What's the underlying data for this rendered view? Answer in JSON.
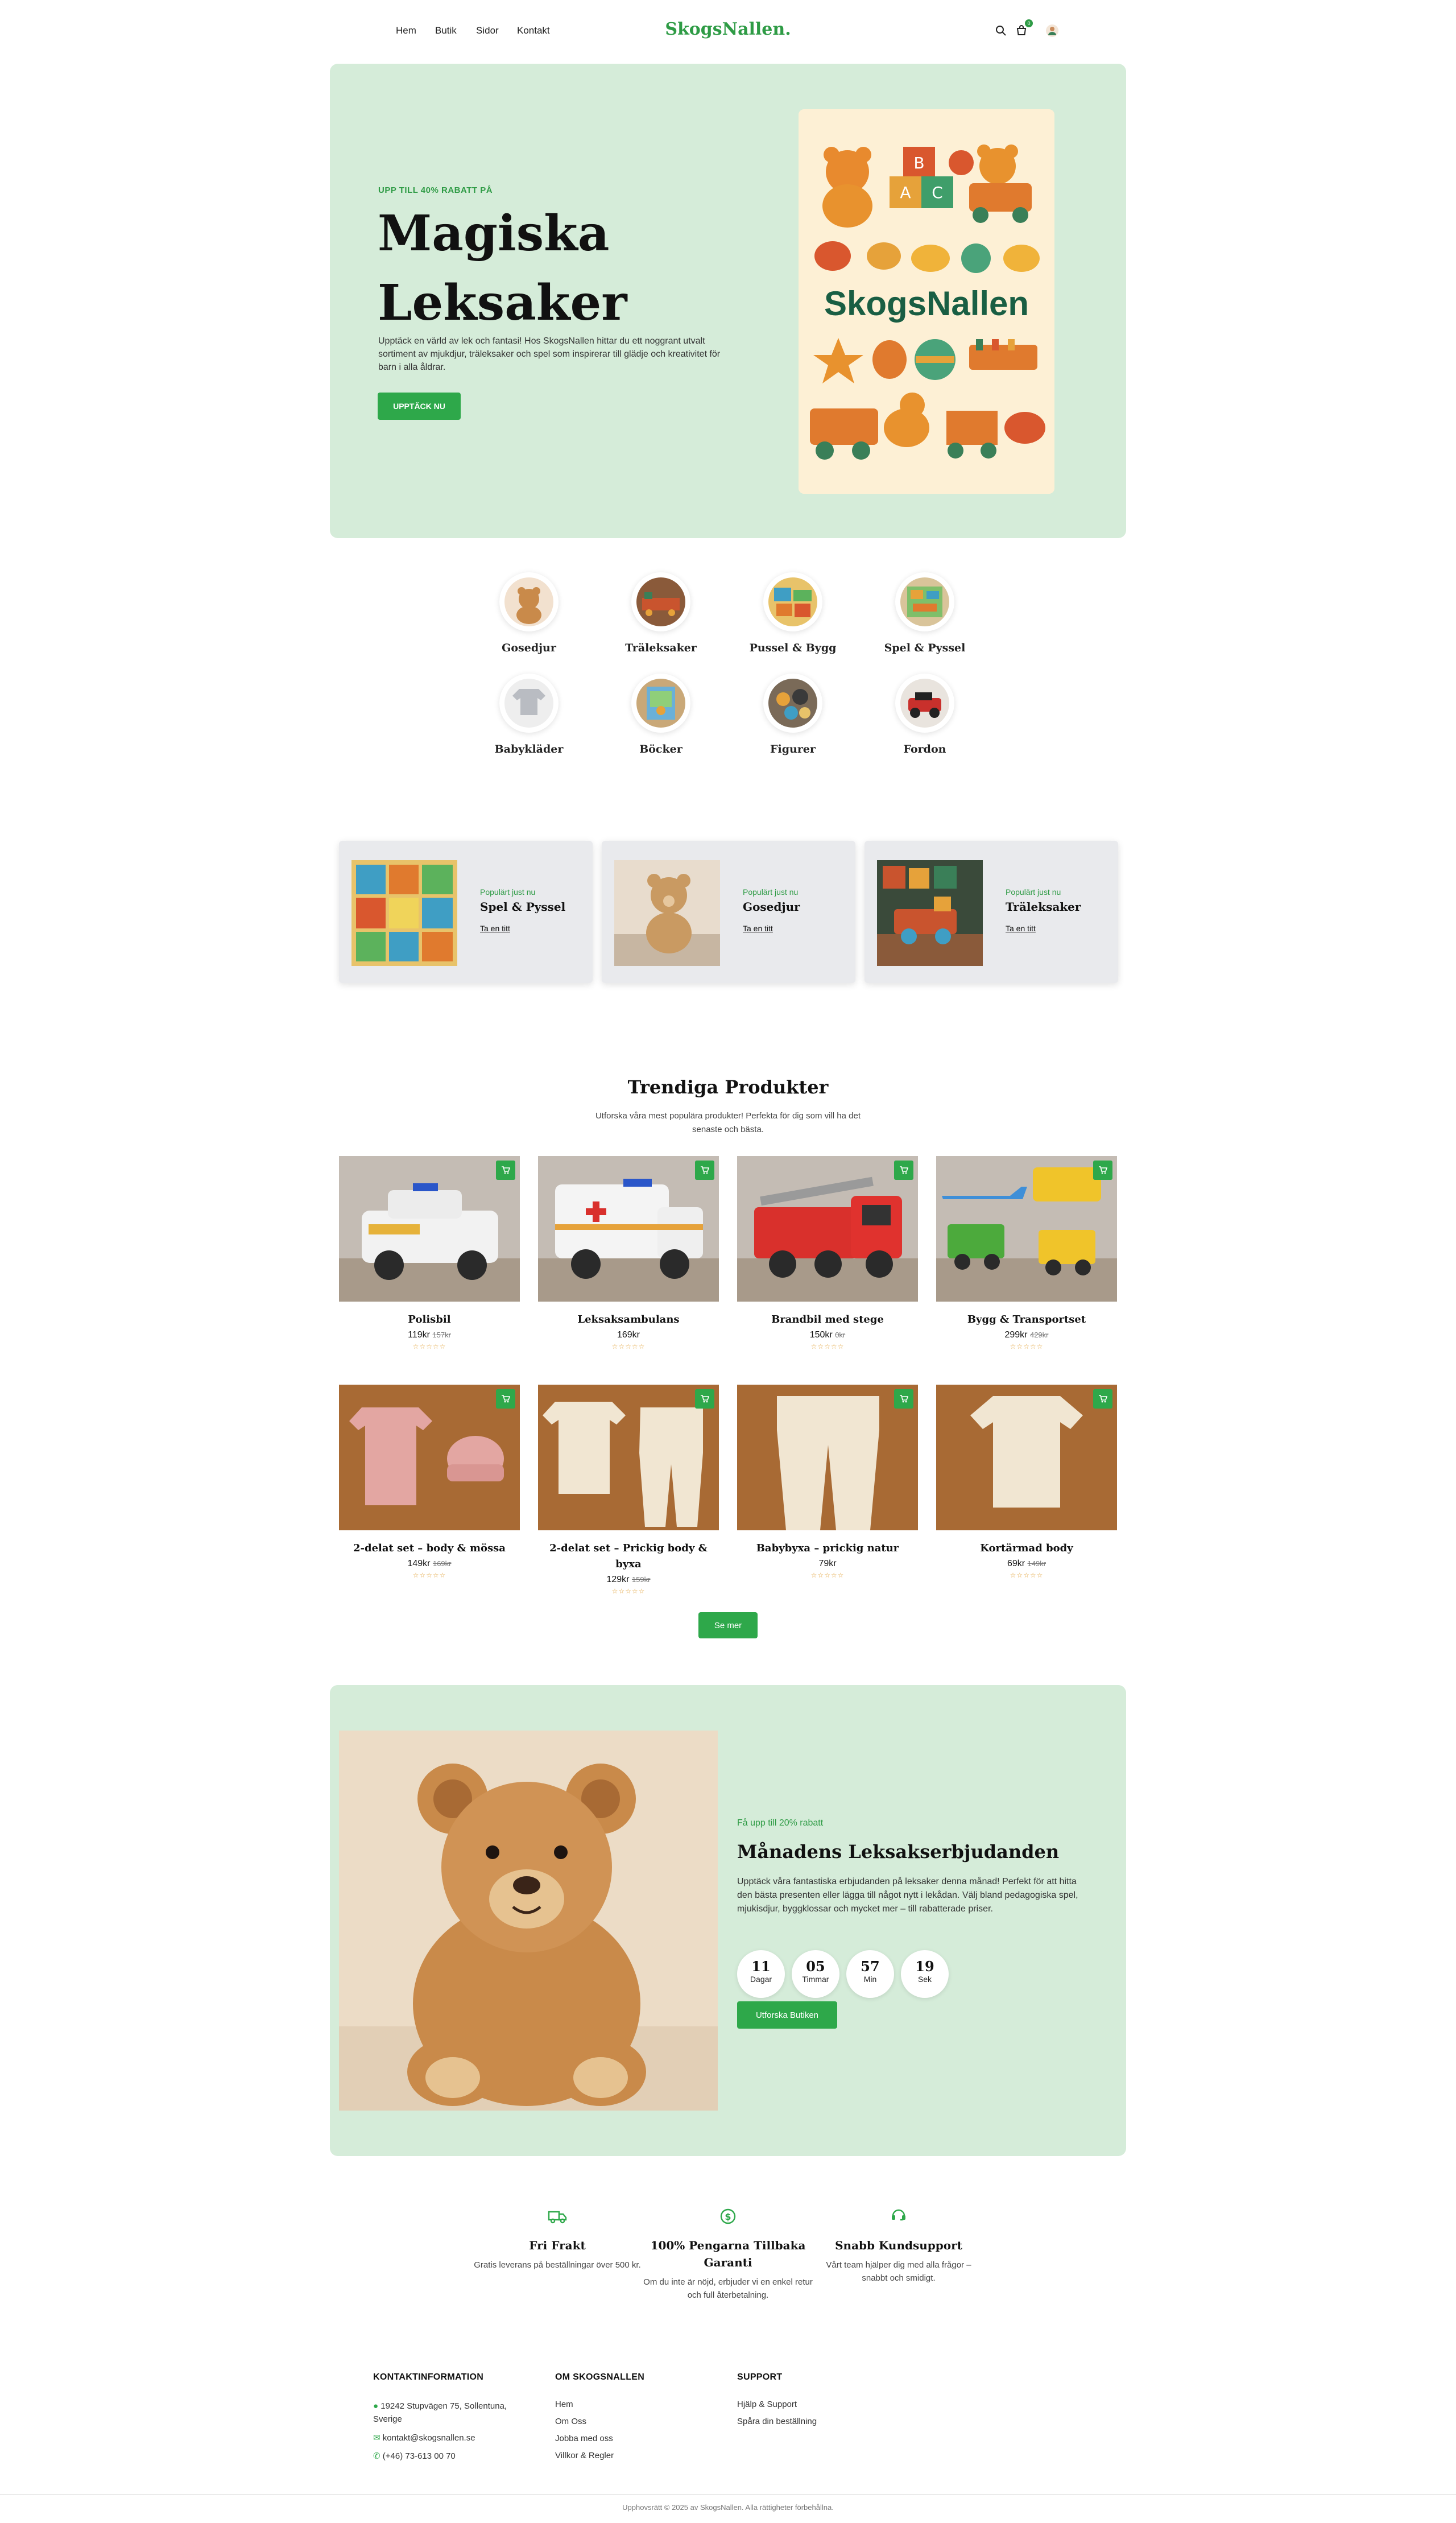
{
  "header": {
    "nav": [
      "Hem",
      "Butik",
      "Sidor",
      "Kontakt"
    ],
    "logo": "SkogsNallen.",
    "cart_count": "0"
  },
  "hero": {
    "eyebrow": "UPP TILL 40% RABATT PÅ",
    "title_line1": "Magiska",
    "title_line2": "Leksaker",
    "description": "Upptäck en värld av lek och fantasi! Hos SkogsNallen hittar du ett noggrant utvalt sortiment av mjukdjur, träleksaker och spel som inspirerar till glädje och kreativitet för barn i alla åldrar.",
    "cta": "UPPTÄCK NU",
    "image_brand": "SkogsNallen"
  },
  "categories": [
    {
      "label": "Gosedjur"
    },
    {
      "label": "Träleksaker"
    },
    {
      "label": "Pussel & Bygg"
    },
    {
      "label": "Spel & Pyssel"
    },
    {
      "label": "Babykläder"
    },
    {
      "label": "Böcker"
    },
    {
      "label": "Figurer"
    },
    {
      "label": "Fordon"
    }
  ],
  "promos": [
    {
      "eyebrow": "Populärt just nu",
      "title": "Spel & Pyssel",
      "link": "Ta en titt"
    },
    {
      "eyebrow": "Populärt just nu",
      "title": "Gosedjur",
      "link": "Ta en titt"
    },
    {
      "eyebrow": "Populärt just nu",
      "title": "Träleksaker",
      "link": "Ta en titt"
    }
  ],
  "trending": {
    "title": "Trendiga Produkter",
    "subtitle": "Utforska våra mest populära produkter! Perfekta för dig som vill ha det senaste och bästa.",
    "more": "Se mer",
    "products": [
      {
        "name": "Polisbil",
        "price": "119kr",
        "old": "157kr"
      },
      {
        "name": "Leksaksambulans",
        "price": "169kr",
        "old": ""
      },
      {
        "name": "Brandbil med stege",
        "price": "150kr",
        "old": "0kr"
      },
      {
        "name": "Bygg & Transportset",
        "price": "299kr",
        "old": "429kr"
      },
      {
        "name": "2-delat set – body & mössa",
        "price": "149kr",
        "old": "169kr"
      },
      {
        "name": "2-delat set – Prickig body & byxa",
        "price": "129kr",
        "old": "159kr"
      },
      {
        "name": "Babybyxa – prickig natur",
        "price": "79kr",
        "old": ""
      },
      {
        "name": "Kortärmad body",
        "price": "69kr",
        "old": "149kr"
      }
    ],
    "stars": "☆☆☆☆☆"
  },
  "deal": {
    "eyebrow": "Få upp till 20% rabatt",
    "title": "Månadens Leksakserbjudanden",
    "description": "Upptäck våra fantastiska erbjudanden på leksaker denna månad! Perfekt för att hitta den bästa presenten eller lägga till något nytt i lekådan. Välj bland pedagogiska spel, mjukisdjur, byggklossar och mycket mer – till rabatterade priser.",
    "countdown": [
      {
        "num": "11",
        "label": "Dagar"
      },
      {
        "num": "05",
        "label": "Timmar"
      },
      {
        "num": "57",
        "label": "Min"
      },
      {
        "num": "19",
        "label": "Sek"
      }
    ],
    "cta": "Utforska Butiken"
  },
  "features": [
    {
      "icon": "truck-icon",
      "title": "Fri Frakt",
      "desc": "Gratis leverans på beställningar över 500 kr."
    },
    {
      "icon": "money-back-icon",
      "title": "100% Pengarna Tillbaka Garanti",
      "desc": "Om du inte är nöjd, erbjuder vi en enkel retur och full återbetalning."
    },
    {
      "icon": "support-icon",
      "title": "Snabb Kundsupport",
      "desc": "Vårt team hjälper dig med alla frågor – snabbt och smidigt."
    }
  ],
  "footer": {
    "contact_title": "KONTAKTINFORMATION",
    "address": "19242 Stupvägen 75, Sollentuna, Sverige",
    "email": "kontakt@skogsnallen.se",
    "phone": "(+46) 73-613 00 70",
    "about_title": "OM SKOGSNALLEN",
    "about_links": [
      "Hem",
      "Om Oss",
      "Jobba med oss",
      "Villkor & Regler"
    ],
    "support_title": "SUPPORT",
    "support_links": [
      "Hjälp & Support",
      "Spåra din beställning"
    ],
    "copyright": "Upphovsrätt © 2025 av SkogsNallen. Alla rättigheter förbehållna."
  },
  "colors": {
    "accent": "#2ea84a",
    "hero_bg": "#d5ecd9",
    "card_bg": "#e9eaed"
  }
}
